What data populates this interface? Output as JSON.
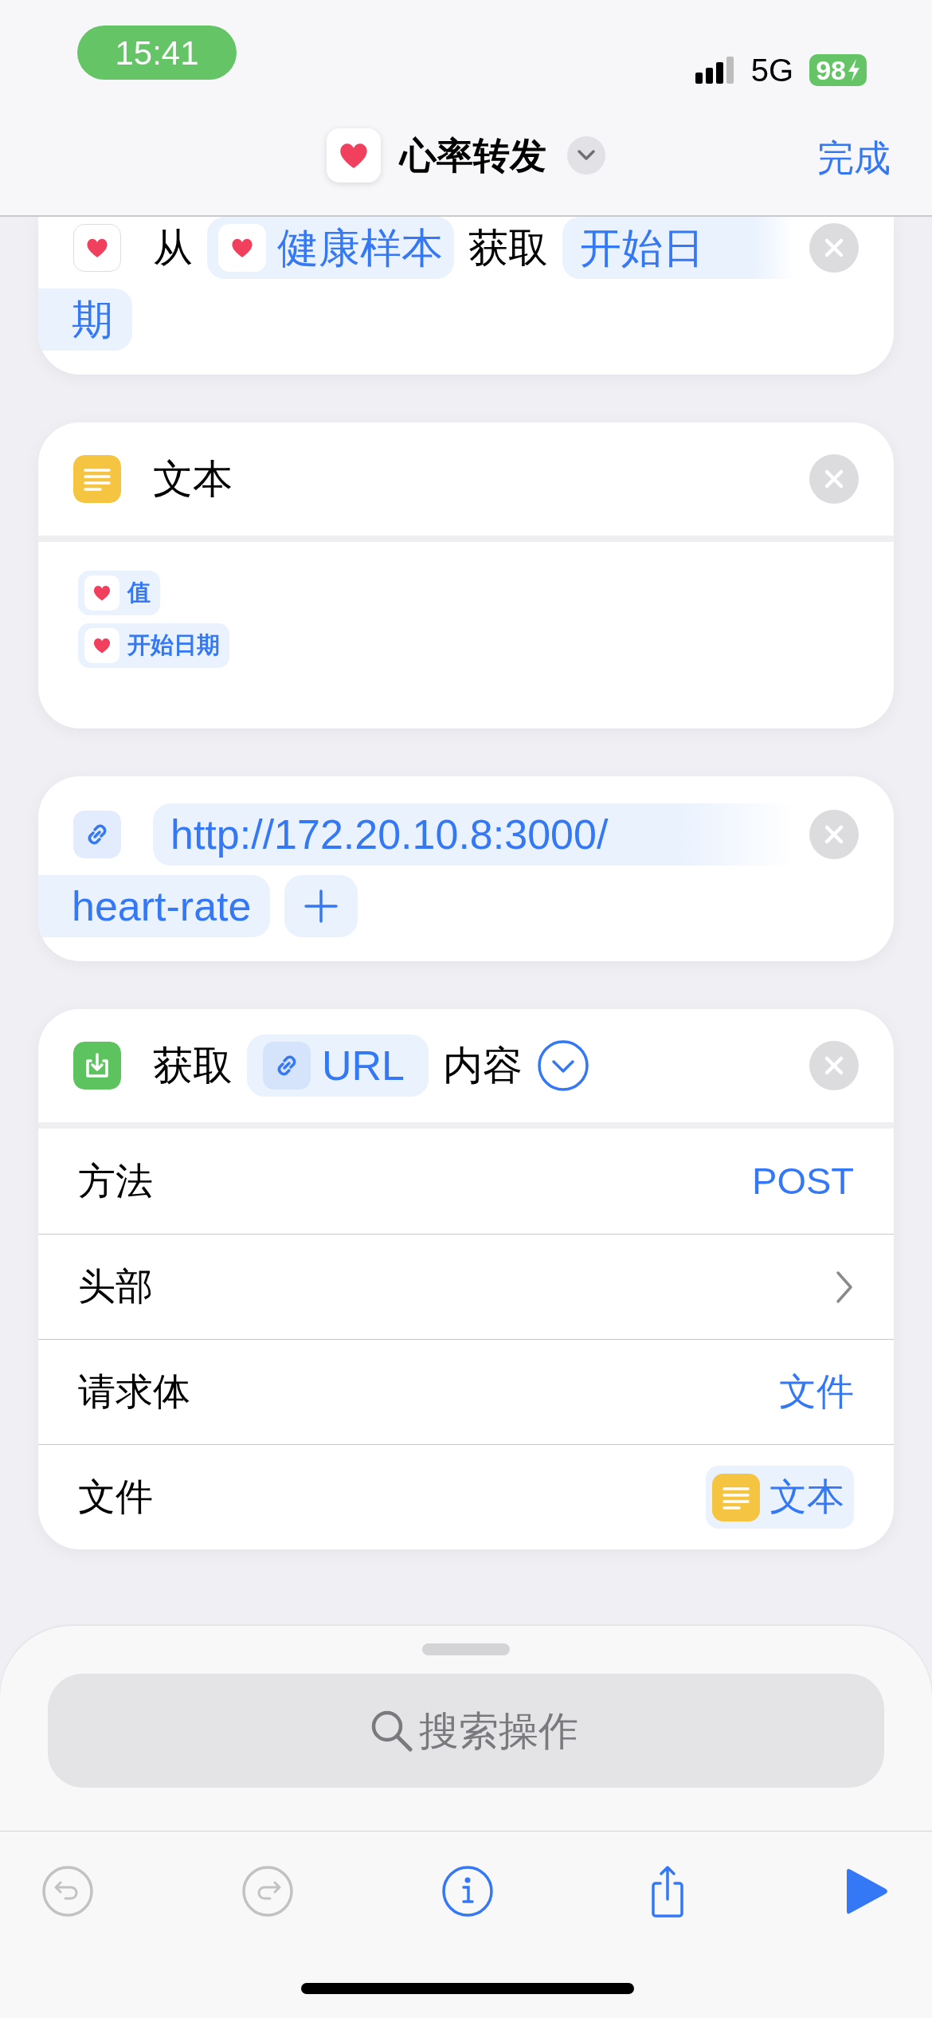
{
  "status_bar": {
    "time": "15:41",
    "network": "5G",
    "battery": "98"
  },
  "nav": {
    "title": "心率转发",
    "done": "完成"
  },
  "actions": [
    {
      "kind": "health",
      "lines": [
        [
          {
            "kind": "word",
            "text": "从"
          },
          {
            "kind": "healthvar",
            "text": "健康样本"
          },
          {
            "kind": "word",
            "text": "获取"
          },
          {
            "kind": "var",
            "text": "开始日"
          }
        ],
        [
          {
            "kind": "var",
            "text": "期"
          }
        ]
      ]
    },
    {
      "kind": "text",
      "lines": [
        [
          {
            "kind": "word",
            "text": "文本"
          }
        ]
      ],
      "body": [
        {
          "kind": "healthvar",
          "text": "值"
        },
        {
          "kind": "healthvar",
          "text": "开始日期"
        }
      ]
    },
    {
      "kind": "url",
      "lines": [
        [
          {
            "kind": "var",
            "text": "http://172.20.10.8:3000/"
          }
        ],
        [
          {
            "kind": "var",
            "text": "heart-rate"
          },
          {
            "kind": "add"
          }
        ]
      ]
    },
    {
      "kind": "download",
      "lines": [
        [
          {
            "kind": "word",
            "text": "获取"
          },
          {
            "kind": "linkvar",
            "text": "URL"
          },
          {
            "kind": "word",
            "text": "内容"
          },
          {
            "kind": "expand"
          }
        ]
      ],
      "rows": [
        {
          "kind": "value",
          "label": "方法",
          "value": "POST"
        },
        {
          "kind": "disclosure",
          "label": "头部"
        },
        {
          "kind": "value",
          "label": "请求体",
          "value": "文件"
        },
        {
          "kind": "token",
          "label": "文件",
          "token": {
            "text": "文本"
          }
        }
      ]
    }
  ],
  "search": {
    "placeholder": "搜索操作"
  },
  "toolbar": [
    {
      "kind": "undo",
      "disabled": true
    },
    {
      "kind": "redo",
      "disabled": true
    },
    {
      "kind": "info",
      "disabled": false
    },
    {
      "kind": "share",
      "disabled": false
    },
    {
      "kind": "run",
      "disabled": false
    }
  ]
}
